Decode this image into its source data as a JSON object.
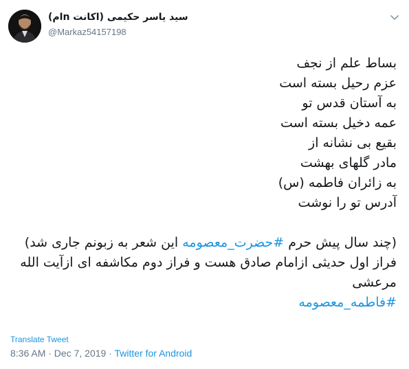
{
  "user": {
    "display_name": "سید یاسر حکیمی (اکانت nام)",
    "username": "@Markaz54157198"
  },
  "tweet": {
    "lines": [
      "بساط علم از نجف",
      "عزم رحیل بسته است",
      "به آستان قدس تو",
      "عمه دخیل بسته است",
      "بقیع بی نشانه از",
      "مادر گلهای بهشت",
      "به زائران فاطمه (س)",
      "آدرس تو را نوشت"
    ],
    "note_prefix": "(چند سال پیش حرم ",
    "note_hashtag": "#حضرت_معصومه",
    "note_suffix": " این شعر به زبونم جاری شد)",
    "note_line2": "فراز اول حدیثی ازامام صادق هست و فراز دوم مکاشفه ای ازآیت الله",
    "note_line3": "مرعشی",
    "hashtag_line": "#فاطمه_معصومه"
  },
  "footer": {
    "translate": "Translate Tweet",
    "timestamp": "8:36 AM · Dec 7, 2019 · ",
    "source": "Twitter for Android"
  },
  "colors": {
    "link": "#1b95e0",
    "muted": "#657786",
    "text": "#14171a"
  },
  "icons": {
    "avatar": "profile-photo",
    "caret": "chevron-down-icon"
  }
}
